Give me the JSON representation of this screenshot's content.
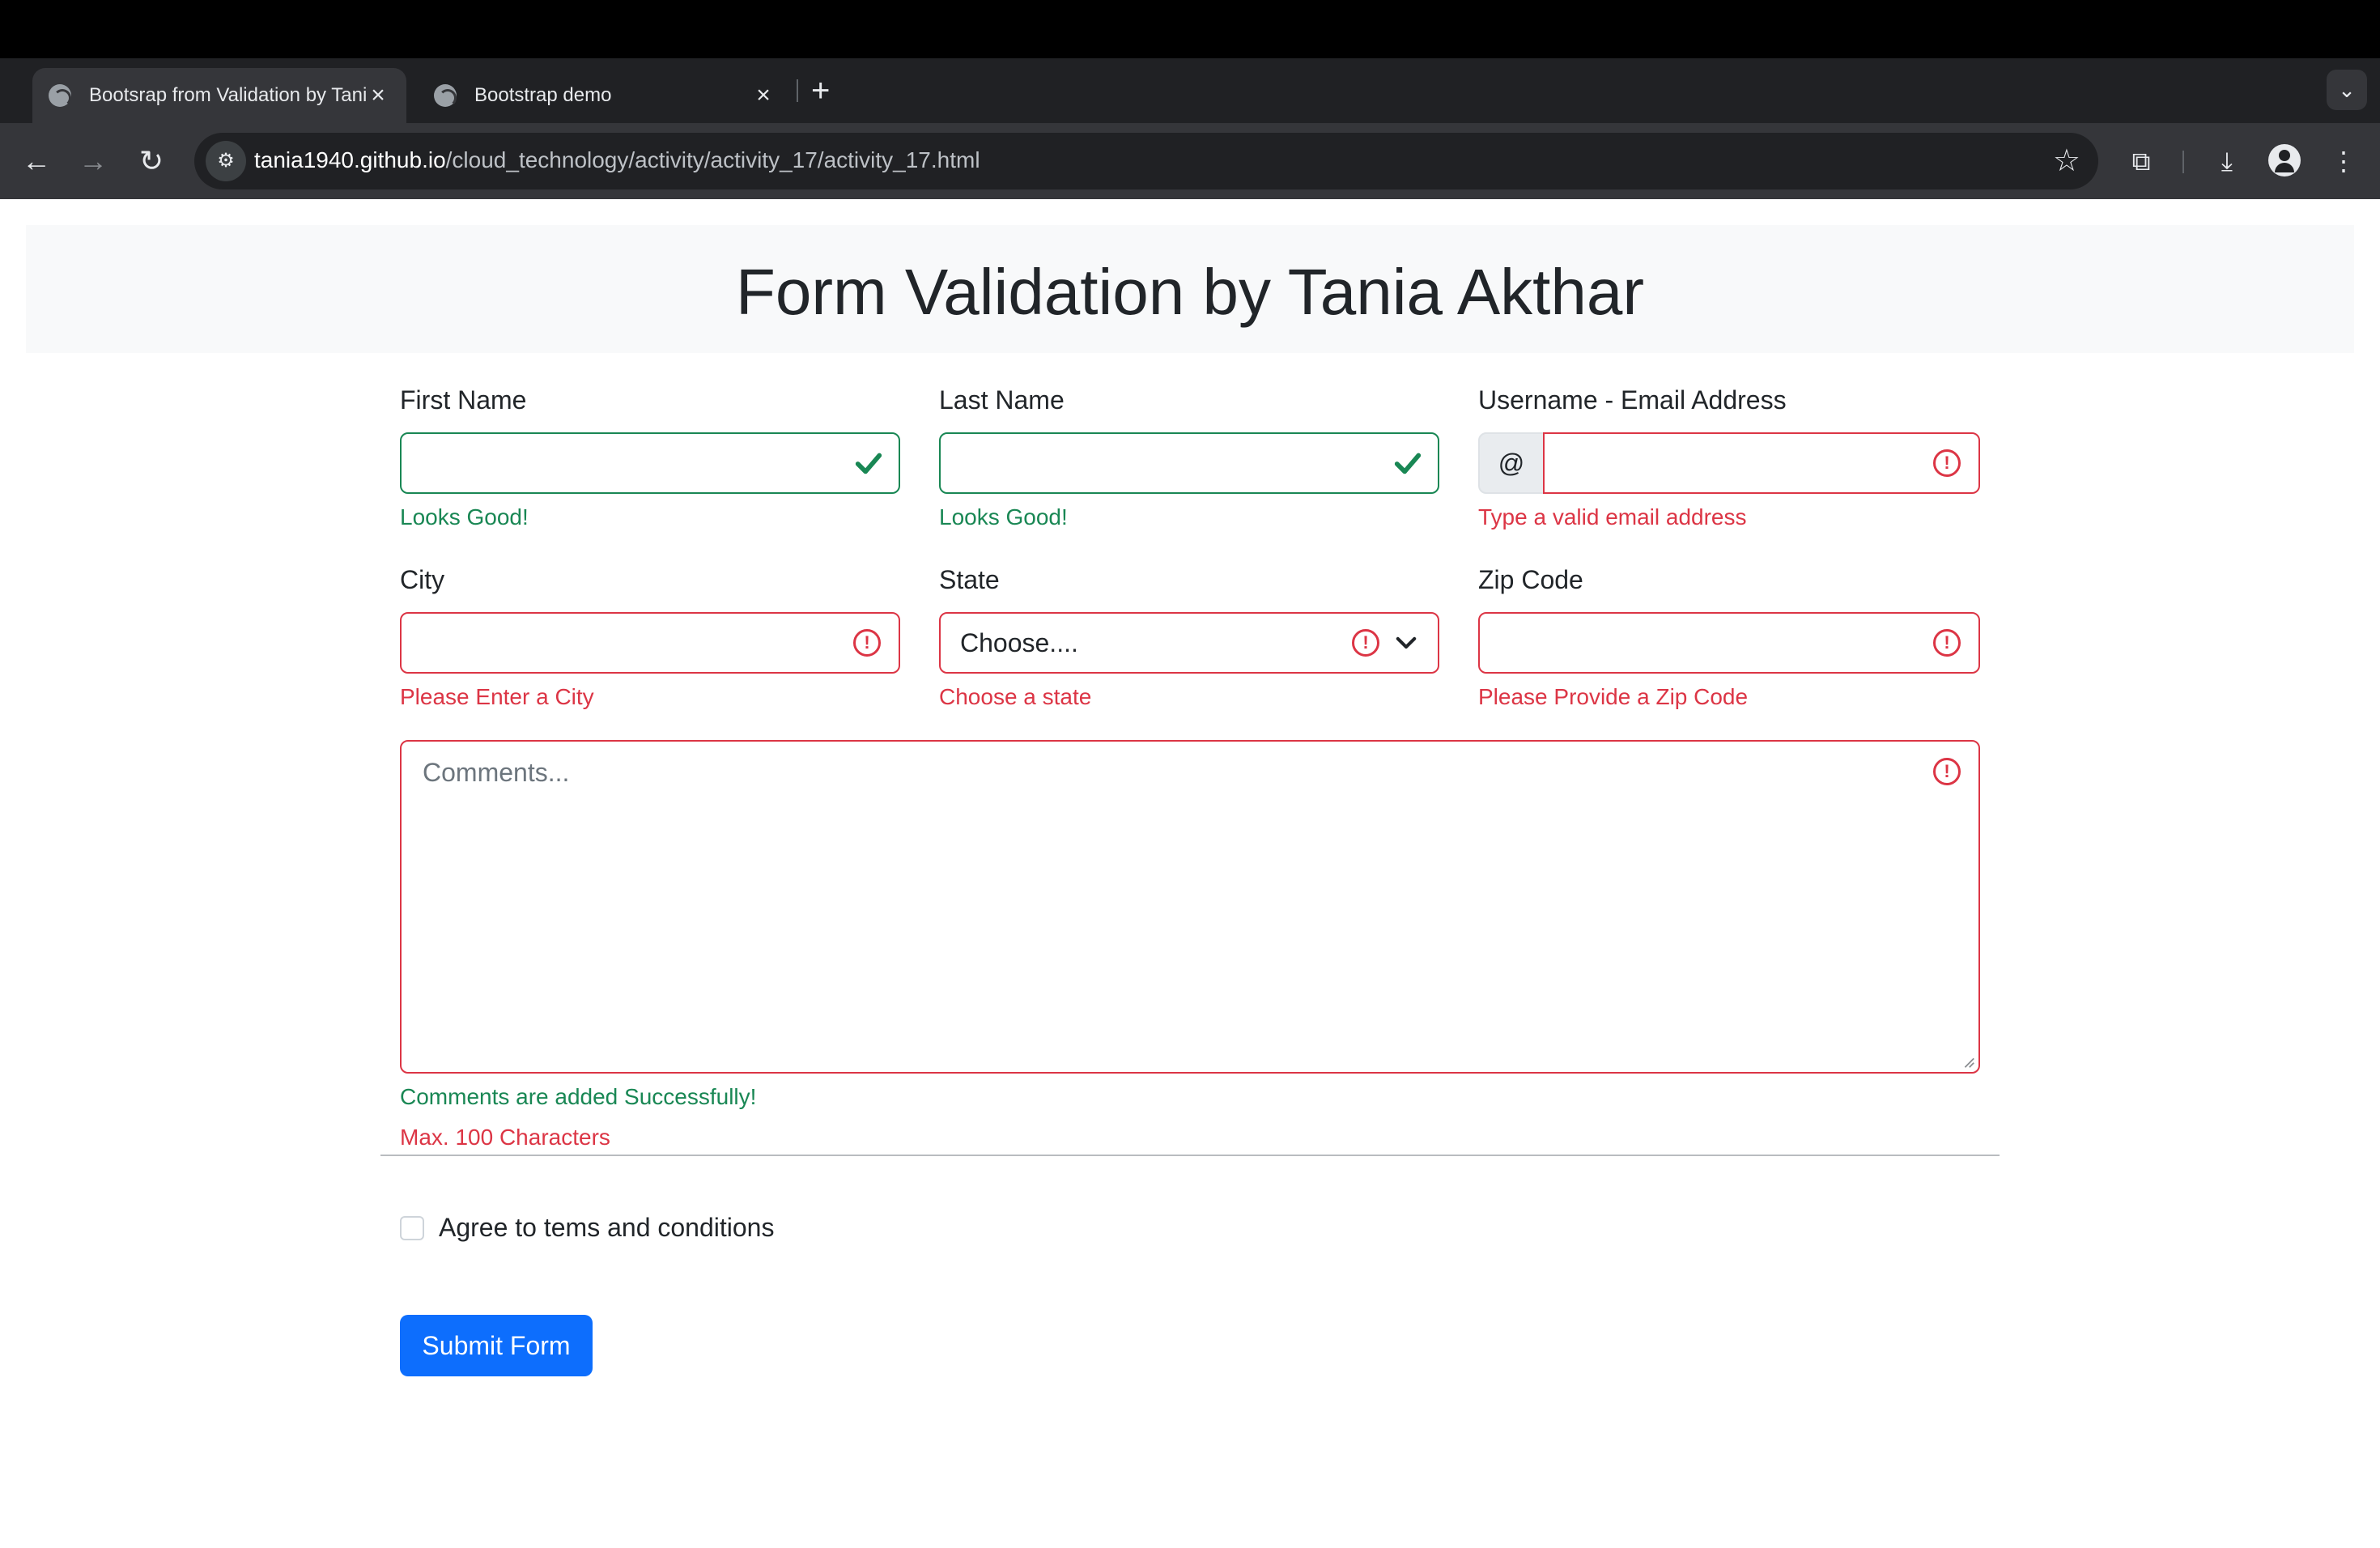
{
  "browser": {
    "tabs": [
      {
        "title": "Bootsrap from Validation by Tania Akthar",
        "active": true
      },
      {
        "title": "Bootstrap demo",
        "active": false
      }
    ],
    "url_host": "tania1940.github.io",
    "url_path": "/cloud_technology/activity/activity_17/activity_17.html"
  },
  "page": {
    "title": "Form Validation by Tania Akthar"
  },
  "form": {
    "first_name": {
      "label": "First Name",
      "value": "",
      "feedback": "Looks Good!"
    },
    "last_name": {
      "label": "Last Name",
      "value": "",
      "feedback": "Looks Good!"
    },
    "username": {
      "label": "Username - Email Address",
      "addon": "@",
      "value": "",
      "feedback": "Type a valid email address"
    },
    "city": {
      "label": "City",
      "value": "",
      "feedback": "Please Enter a City"
    },
    "state": {
      "label": "State",
      "selected": "Choose....",
      "feedback": "Choose a state"
    },
    "zip": {
      "label": "Zip Code",
      "value": "",
      "feedback": "Please Provide a Zip Code"
    },
    "comments": {
      "placeholder": "Comments...",
      "feedback_ok": "Comments are added Successfully!",
      "feedback_err": "Max. 100 Characters"
    },
    "agree": {
      "label": "Agree to tems and conditions",
      "checked": false
    },
    "submit_label": "Submit Form"
  },
  "colors": {
    "valid": "#198754",
    "invalid": "#dc3545",
    "primary": "#0d6efd"
  }
}
